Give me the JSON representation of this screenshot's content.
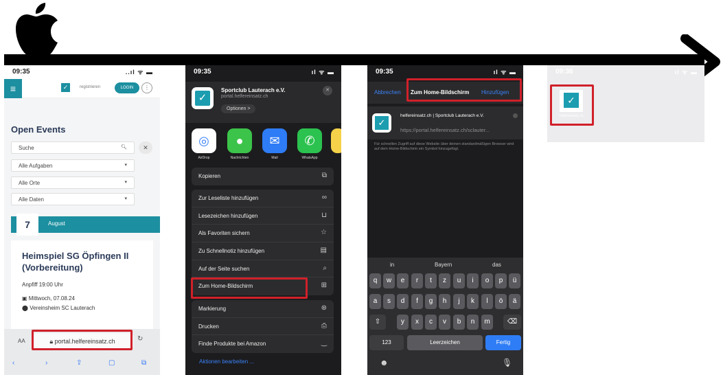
{
  "phone1": {
    "time": "09:35",
    "status_icons": "..ıl ᯤ ▬",
    "register_label": "registrieren",
    "login_label": "LOGIN",
    "title": "Open Events",
    "search_placeholder": "Suche",
    "filters": [
      "Alle Aufgaben",
      "Alle Orte",
      "Alle Daten"
    ],
    "date_day": "7",
    "date_month": "August",
    "event_title": "Heimspiel SG Öpfingen II (Vorbereitung)",
    "kickoff": "Anpfiff 19:00 Uhr",
    "event_date": "Mittwoch, 07.08.24",
    "event_venue": "Vereinsheim SC Lauterach",
    "aa_label": "AA",
    "url": "portal.helfereinsatz.ch"
  },
  "phone2": {
    "time": "09:35",
    "site_name": "Sportclub Lauterach e.V.",
    "site_domain": "portal.helfereinsatz.ch",
    "options_label": "Optionen >",
    "apps": [
      {
        "label": "AirDrop",
        "color": "#ffffff"
      },
      {
        "label": "Nachrichten",
        "color": "#3cc34a"
      },
      {
        "label": "Mail",
        "color": "#2e7cf6"
      },
      {
        "label": "WhatsApp",
        "color": "#2bc24f"
      }
    ],
    "copy_label": "Kopieren",
    "actions": [
      "Zur Leseliste hinzufügen",
      "Lesezeichen hinzufügen",
      "Als Favoriten sichern",
      "Zu Schnellnotiz hinzufügen",
      "Auf der Seite suchen",
      "Zum Home-Bildschirm"
    ],
    "actions2": [
      "Markierung",
      "Drucken",
      "Finde Produkte bei Amazon"
    ],
    "edit_actions_label": "Aktionen bearbeiten ..."
  },
  "phone3": {
    "time": "09:35",
    "cancel_label": "Abbrechen",
    "title": "Zum Home-Bildschirm",
    "add_label": "Hinzufügen",
    "name_value": "helfereinsatz.ch | Sportclub Lauterach e.V.",
    "url_value": "https://portal.helfereinsatz.ch/sclauter...",
    "help_text": "Für schnellen Zugriff auf diese Website über deinen standardmäßigen Browser wird auf dem Home-Bildschirm ein Symbol hinzugefügt.",
    "suggestions": [
      "in",
      "Bayern",
      "das"
    ],
    "row1": [
      "q",
      "w",
      "e",
      "r",
      "t",
      "z",
      "u",
      "i",
      "o",
      "p",
      "ü"
    ],
    "row2": [
      "a",
      "s",
      "d",
      "f",
      "g",
      "h",
      "j",
      "k",
      "l",
      "ö",
      "ä"
    ],
    "row3": [
      "y",
      "x",
      "c",
      "v",
      "b",
      "n",
      "m"
    ],
    "numbers_key": "123",
    "space_key": "Leerzeichen",
    "done_key": "Fertig"
  },
  "phone4": {
    "time": "09:36",
    "app_label": "helfereinsatz.ch"
  }
}
